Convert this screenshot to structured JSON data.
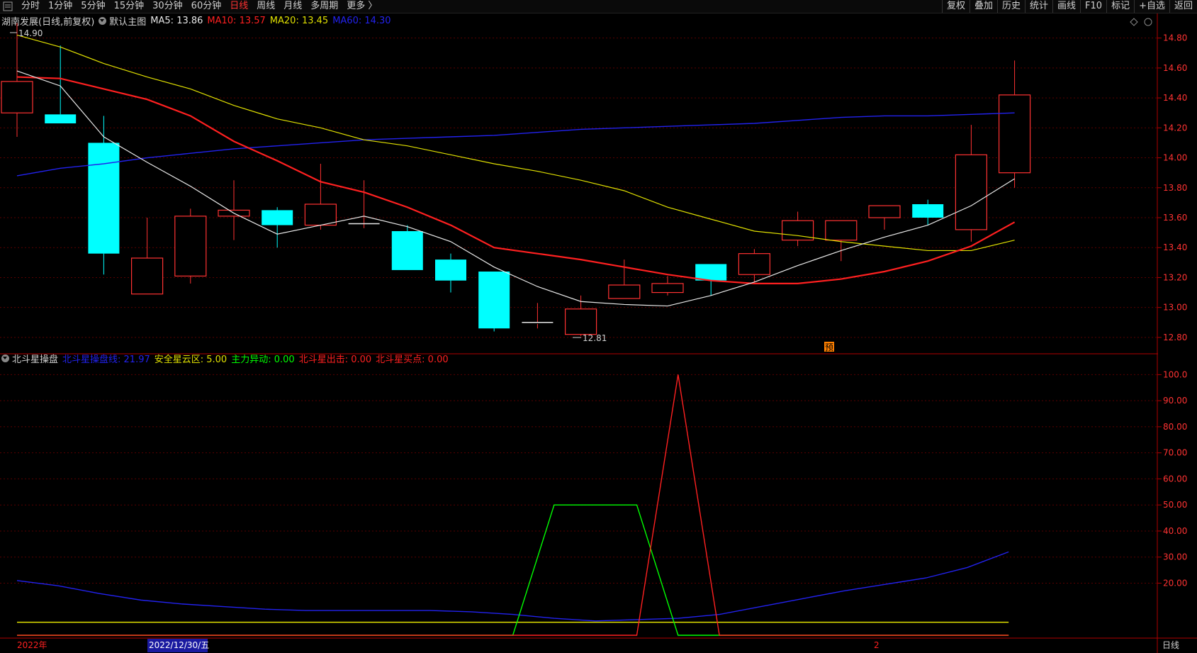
{
  "toolbar": {
    "periods": [
      {
        "label": "分时",
        "active": false
      },
      {
        "label": "1分钟",
        "active": false
      },
      {
        "label": "5分钟",
        "active": false
      },
      {
        "label": "15分钟",
        "active": false
      },
      {
        "label": "30分钟",
        "active": false
      },
      {
        "label": "60分钟",
        "active": false
      },
      {
        "label": "日线",
        "active": true
      },
      {
        "label": "周线",
        "active": false
      },
      {
        "label": "月线",
        "active": false
      },
      {
        "label": "多周期",
        "active": false
      },
      {
        "label": "更多 〉",
        "active": false
      }
    ],
    "actions": [
      "复权",
      "叠加",
      "历史",
      "统计",
      "画线",
      "F10",
      "标记",
      "+自选",
      "返回"
    ]
  },
  "main_legend": {
    "stock": "湖南发展(日线,前复权)",
    "template": "默认主图",
    "ma5": "MA5: 13.86",
    "ma10": "MA10: 13.57",
    "ma20": "MA20: 13.45",
    "ma60": "MA60: 14.30"
  },
  "sub_legend": {
    "name": "北斗星操盘",
    "line1": "北斗星操盘线: 21.97",
    "line2": "安全星云区: 5.00",
    "line3": "主力异动: 0.00",
    "line4": "北斗星出击: 0.00",
    "line5": "北斗星买点: 0.00"
  },
  "annotations": {
    "high": "14.90",
    "low": "12.81",
    "forecast_marker": "预"
  },
  "footer": {
    "year": "2022年",
    "cursor_date": "2022/12/30/五",
    "month": "2",
    "period": "日线"
  },
  "colors": {
    "up": "#ff3232",
    "down": "#00ffff",
    "ma5": "#e8e8e8",
    "ma10": "#ff2020",
    "ma20": "#e0e000",
    "ma60": "#2222ee",
    "grid": "#5a0000",
    "axis": "#b00000"
  },
  "chart_data": [
    {
      "type": "candlestick",
      "title": "湖南发展(日线,前复权)",
      "ylim": [
        12.7,
        14.95
      ],
      "yticks": [
        "14.80",
        "14.60",
        "14.40",
        "14.20",
        "14.00",
        "13.80",
        "13.60",
        "13.40",
        "13.20",
        "13.00",
        "12.80"
      ],
      "candles": [
        {
          "o": 14.3,
          "h": 14.9,
          "l": 14.14,
          "c": 14.51
        },
        {
          "o": 14.29,
          "h": 14.75,
          "l": 14.24,
          "c": 14.23
        },
        {
          "o": 14.1,
          "h": 14.28,
          "l": 13.22,
          "c": 13.36
        },
        {
          "o": 13.09,
          "h": 13.6,
          "l": 13.09,
          "c": 13.33
        },
        {
          "o": 13.21,
          "h": 13.66,
          "l": 13.16,
          "c": 13.61
        },
        {
          "o": 13.61,
          "h": 13.85,
          "l": 13.45,
          "c": 13.65
        },
        {
          "o": 13.65,
          "h": 13.67,
          "l": 13.4,
          "c": 13.55
        },
        {
          "o": 13.55,
          "h": 13.96,
          "l": 13.52,
          "c": 13.69
        },
        {
          "o": 13.56,
          "h": 13.85,
          "l": 13.53,
          "c": 13.56
        },
        {
          "o": 13.51,
          "h": 13.55,
          "l": 13.25,
          "c": 13.25
        },
        {
          "o": 13.32,
          "h": 13.36,
          "l": 13.1,
          "c": 13.18
        },
        {
          "o": 13.24,
          "h": 13.24,
          "l": 12.84,
          "c": 12.86
        },
        {
          "o": 12.89,
          "h": 13.03,
          "l": 12.86,
          "c": 12.9
        },
        {
          "o": 12.82,
          "h": 13.08,
          "l": 12.81,
          "c": 12.99
        },
        {
          "o": 13.06,
          "h": 13.32,
          "l": 13.06,
          "c": 13.15
        },
        {
          "o": 13.1,
          "h": 13.21,
          "l": 13.08,
          "c": 13.16
        },
        {
          "o": 13.29,
          "h": 13.29,
          "l": 13.08,
          "c": 13.18
        },
        {
          "o": 13.22,
          "h": 13.39,
          "l": 13.17,
          "c": 13.36
        },
        {
          "o": 13.45,
          "h": 13.64,
          "l": 13.41,
          "c": 13.58
        },
        {
          "o": 13.45,
          "h": 13.58,
          "l": 13.31,
          "c": 13.58
        },
        {
          "o": 13.6,
          "h": 13.68,
          "l": 13.52,
          "c": 13.68
        },
        {
          "o": 13.69,
          "h": 13.72,
          "l": 13.55,
          "c": 13.6
        },
        {
          "o": 13.52,
          "h": 14.22,
          "l": 13.44,
          "c": 14.02
        },
        {
          "o": 13.9,
          "h": 14.65,
          "l": 13.8,
          "c": 14.42
        }
      ],
      "ma5": [
        14.58,
        14.48,
        14.14,
        13.97,
        13.81,
        13.63,
        13.49,
        13.55,
        13.61,
        13.54,
        13.44,
        13.27,
        13.14,
        13.04,
        13.02,
        13.01,
        13.08,
        13.17,
        13.28,
        13.38,
        13.47,
        13.55,
        13.68,
        13.86
      ],
      "ma10": [
        14.54,
        14.53,
        14.46,
        14.39,
        14.28,
        14.11,
        13.98,
        13.84,
        13.77,
        13.67,
        13.55,
        13.4,
        13.36,
        13.32,
        13.27,
        13.22,
        13.18,
        13.16,
        13.16,
        13.19,
        13.24,
        13.31,
        13.41,
        13.57
      ],
      "ma20": [
        14.82,
        14.74,
        14.63,
        14.54,
        14.46,
        14.35,
        14.26,
        14.2,
        14.12,
        14.08,
        14.02,
        13.96,
        13.91,
        13.85,
        13.78,
        13.67,
        13.59,
        13.51,
        13.48,
        13.44,
        13.41,
        13.38,
        13.38,
        13.45
      ],
      "ma60": [
        13.88,
        13.93,
        13.96,
        14.0,
        14.03,
        14.06,
        14.08,
        14.1,
        14.12,
        14.13,
        14.14,
        14.15,
        14.17,
        14.19,
        14.2,
        14.21,
        14.22,
        14.23,
        14.25,
        14.27,
        14.28,
        14.28,
        14.29,
        14.3
      ]
    },
    {
      "type": "line",
      "title": "北斗星操盘",
      "ylim": [
        0,
        105
      ],
      "yticks": [
        "100.0",
        "90.00",
        "80.00",
        "70.00",
        "60.00",
        "50.00",
        "40.00",
        "30.00",
        "20.00"
      ],
      "series": [
        {
          "name": "北斗星操盘线",
          "color": "#2222ee",
          "values": [
            21,
            19,
            16,
            13.5,
            12,
            11,
            10,
            9.5,
            9.5,
            9.5,
            9.5,
            9,
            8,
            6.5,
            5.5,
            6,
            6.5,
            8,
            11,
            14,
            17,
            19.5,
            22,
            26,
            32
          ]
        },
        {
          "name": "安全星云区",
          "color": "#e0e000",
          "values": [
            5,
            5,
            5,
            5,
            5,
            5,
            5,
            5,
            5,
            5,
            5,
            5,
            5,
            5,
            5,
            5,
            5,
            5,
            5,
            5,
            5,
            5,
            5,
            5,
            5
          ]
        },
        {
          "name": "主力异动",
          "color": "#00ff00",
          "values": [
            0,
            0,
            0,
            0,
            0,
            0,
            0,
            0,
            0,
            0,
            0,
            0,
            0,
            50,
            50,
            50,
            0,
            0,
            0,
            0,
            0,
            0,
            0,
            0,
            0
          ]
        },
        {
          "name": "北斗星出击",
          "color": "#ff2020",
          "values": [
            0,
            0,
            0,
            0,
            0,
            0,
            0,
            0,
            0,
            0,
            0,
            0,
            0,
            0,
            0,
            0,
            100,
            0,
            0,
            0,
            0,
            0,
            0,
            0,
            0
          ]
        }
      ]
    }
  ]
}
